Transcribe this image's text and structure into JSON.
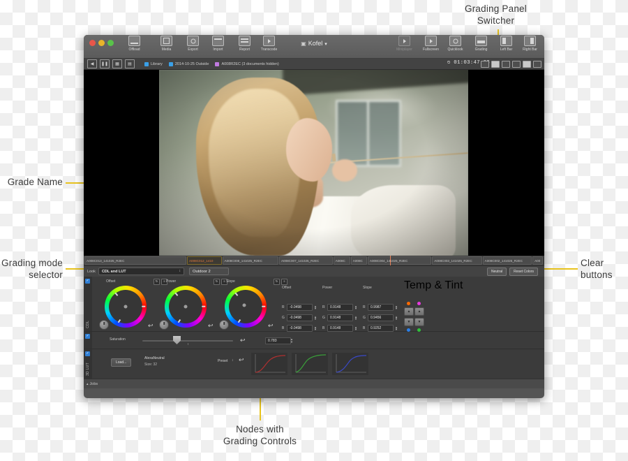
{
  "annotations": [
    {
      "id": "grading-panel-switcher",
      "text": "Grading Panel\nSwitcher"
    },
    {
      "id": "grade-name",
      "text": "Grade Name"
    },
    {
      "id": "grading-mode-selector",
      "text": "Grading mode\nselector"
    },
    {
      "id": "clear-buttons",
      "text": "Clear\nbuttons"
    },
    {
      "id": "nodes-with-grading-controls",
      "text": "Nodes with\nGrading Controls"
    }
  ],
  "window": {
    "title": "Kofel",
    "title_caret": "▾",
    "title_doc_icon": "▣",
    "toolbar_left": [
      {
        "label": "Offload",
        "icon": "offload-icon",
        "dim": false
      },
      {
        "label": "Media",
        "icon": "media-icon",
        "dim": false
      },
      {
        "label": "Export",
        "icon": "export-icon",
        "dim": false
      },
      {
        "label": "Import",
        "icon": "import-icon",
        "dim": false
      },
      {
        "label": "Report",
        "icon": "report-icon",
        "dim": false
      },
      {
        "label": "Transcode",
        "icon": "transcode-icon",
        "dim": false
      }
    ],
    "toolbar_right": [
      {
        "label": "Miniplayer",
        "icon": "miniplayer-icon",
        "dim": true,
        "selected": false
      },
      {
        "label": "Fullscreen",
        "icon": "fullscreen-icon",
        "dim": false,
        "selected": false
      },
      {
        "label": "Quicklook",
        "icon": "quicklook-icon",
        "dim": false,
        "selected": false
      },
      {
        "label": "Grading",
        "icon": "grading-icon",
        "dim": false,
        "selected": true
      },
      {
        "label": "Left Bar",
        "icon": "left-bar-icon",
        "dim": false,
        "selected": false
      },
      {
        "label": "Right Bar",
        "icon": "right-bar-icon",
        "dim": false,
        "selected": false
      }
    ]
  },
  "pathbar": {
    "crumbs": [
      {
        "label": "Library",
        "color": "#3aa0e8"
      },
      {
        "label": "2014-10-25 Outside",
        "color": "#3aa0e8"
      },
      {
        "label": "A008R2EC (3 documents hidden)",
        "color": "#c07ae0"
      }
    ],
    "timecode": "01:03:47.08"
  },
  "timeline": {
    "clips": [
      {
        "name": "A008C013_141025_R2EC",
        "width": 160,
        "active": false
      },
      {
        "name": "A008C012_1410",
        "width": 54,
        "active": true
      },
      {
        "name": "A008C008_141025_R2EC",
        "width": 88,
        "active": false
      },
      {
        "name": "A008C007_141025_R2EC",
        "width": 84,
        "active": false
      },
      {
        "name": "A008C",
        "width": 26,
        "active": false
      },
      {
        "name": "A008C",
        "width": 25,
        "active": false
      },
      {
        "name": "A008C004_141025_R2EC",
        "width": 100,
        "active": false
      },
      {
        "name": "A008C003_141025_R2EC",
        "width": 78,
        "active": false
      },
      {
        "name": "A008C002_141025_R2EC",
        "width": 77,
        "active": false
      },
      {
        "name": "A00",
        "width": 16,
        "active": false
      }
    ]
  },
  "lookbar": {
    "look_label": "Look",
    "look_mode": "CDL and LUT",
    "look_caret": "↕",
    "grade_name": "Outdoor 2",
    "neutral_button": "Neutral",
    "reset_colors_button": "Reset Colors"
  },
  "nodes": {
    "cdl": {
      "rail_label": "CDL",
      "enabled": true,
      "wheels": [
        {
          "label": "Offset",
          "reset_icon": "reset-icon",
          "link_icon": "link-icon"
        },
        {
          "label": "Power",
          "reset_icon": "reset-icon",
          "link_icon": "link-icon"
        },
        {
          "label": "Slope",
          "reset_icon": "reset-icon",
          "link_icon": "link-icon"
        }
      ],
      "numeric_columns": [
        {
          "label": "Offset",
          "rows": [
            {
              "ch": "R",
              "value": "-0.0498"
            },
            {
              "ch": "G",
              "value": "-0.0498"
            },
            {
              "ch": "B",
              "value": "-0.0498"
            }
          ]
        },
        {
          "label": "Power",
          "rows": [
            {
              "ch": "R",
              "value": "0.9148"
            },
            {
              "ch": "G",
              "value": "0.9148"
            },
            {
              "ch": "B",
              "value": "0.9148"
            }
          ]
        },
        {
          "label": "Slope",
          "rows": [
            {
              "ch": "R",
              "value": "0.9987"
            },
            {
              "ch": "G",
              "value": "0.9456"
            },
            {
              "ch": "B",
              "value": "0.9252"
            }
          ]
        }
      ],
      "temp_tint": {
        "label": "Temp & Tint",
        "top_dots": [
          "#ff6a00",
          "#e83ae0"
        ],
        "bottom_dots": [
          "#2a7fe8",
          "#2fc13a"
        ],
        "up_glyph": "▲",
        "down_glyph": "▼"
      }
    },
    "saturation": {
      "enabled": true,
      "label": "Saturation",
      "value": "0.783",
      "reset_icon": "reset-icon"
    },
    "lut": {
      "rail_label": "3D LUT",
      "enabled": true,
      "load_button": "Load...",
      "name": "AlexaNeutral",
      "size": "Size:  32",
      "preset_label": "Preset",
      "preset_caret": "↕",
      "reset_icon": "reset-icon",
      "curves": [
        {
          "channel": "red",
          "color": "#b03030"
        },
        {
          "channel": "green",
          "color": "#3aa03a"
        },
        {
          "channel": "blue",
          "color": "#3a49c8"
        }
      ]
    }
  },
  "statusbar": {
    "jobs_label": "Jobs",
    "disclosure": "▴"
  },
  "colors": {
    "annotation_leader": "#e8c31e",
    "highlight": "#e8c31e",
    "active_clip_text": "#e0783c",
    "checkbox": "#2f7fd6"
  }
}
